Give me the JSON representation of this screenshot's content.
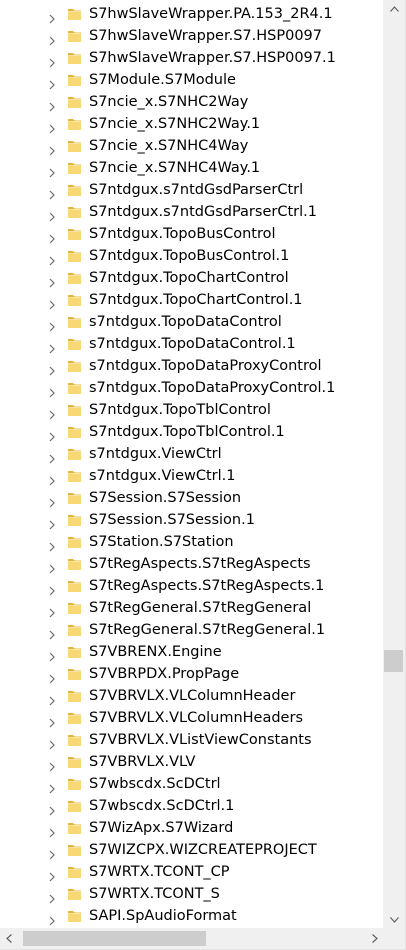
{
  "tree": {
    "items": [
      {
        "label": "S7hwSlaveWrapper.PA.153_2R4.1"
      },
      {
        "label": "S7hwSlaveWrapper.S7.HSP0097"
      },
      {
        "label": "S7hwSlaveWrapper.S7.HSP0097.1"
      },
      {
        "label": "S7Module.S7Module"
      },
      {
        "label": "S7ncie_x.S7NHC2Way"
      },
      {
        "label": "S7ncie_x.S7NHC2Way.1"
      },
      {
        "label": "S7ncie_x.S7NHC4Way"
      },
      {
        "label": "S7ncie_x.S7NHC4Way.1"
      },
      {
        "label": "S7ntdgux.s7ntdGsdParserCtrl"
      },
      {
        "label": "S7ntdgux.s7ntdGsdParserCtrl.1"
      },
      {
        "label": "S7ntdgux.TopoBusControl"
      },
      {
        "label": "S7ntdgux.TopoBusControl.1"
      },
      {
        "label": "S7ntdgux.TopoChartControl"
      },
      {
        "label": "S7ntdgux.TopoChartControl.1"
      },
      {
        "label": "s7ntdgux.TopoDataControl"
      },
      {
        "label": "s7ntdgux.TopoDataControl.1"
      },
      {
        "label": "s7ntdgux.TopoDataProxyControl"
      },
      {
        "label": "s7ntdgux.TopoDataProxyControl.1"
      },
      {
        "label": "S7ntdgux.TopoTblControl"
      },
      {
        "label": "S7ntdgux.TopoTblControl.1"
      },
      {
        "label": "s7ntdgux.ViewCtrl"
      },
      {
        "label": "s7ntdgux.ViewCtrl.1"
      },
      {
        "label": "S7Session.S7Session"
      },
      {
        "label": "S7Session.S7Session.1"
      },
      {
        "label": "S7Station.S7Station"
      },
      {
        "label": "S7tRegAspects.S7tRegAspects"
      },
      {
        "label": "S7tRegAspects.S7tRegAspects.1"
      },
      {
        "label": "S7tRegGeneral.S7tRegGeneral"
      },
      {
        "label": "S7tRegGeneral.S7tRegGeneral.1"
      },
      {
        "label": "S7VBRENX.Engine"
      },
      {
        "label": "S7VBRPDX.PropPage"
      },
      {
        "label": "S7VBRVLX.VLColumnHeader"
      },
      {
        "label": "S7VBRVLX.VLColumnHeaders"
      },
      {
        "label": "S7VBRVLX.VListViewConstants"
      },
      {
        "label": "S7VBRVLX.VLV"
      },
      {
        "label": "S7wbscdx.ScDCtrl"
      },
      {
        "label": "S7wbscdx.ScDCtrl.1"
      },
      {
        "label": "S7WizApx.S7Wizard"
      },
      {
        "label": "S7WIZCPX.WIZCREATEPROJECT"
      },
      {
        "label": "S7WRTX.TCONT_CP"
      },
      {
        "label": "S7WRTX.TCONT_S"
      },
      {
        "label": "SAPI.SpAudioFormat"
      }
    ]
  },
  "icons": {
    "expander": "chevron-right-icon",
    "folder": "folder-icon"
  },
  "colors": {
    "folder_fill": "#f8d775",
    "folder_dark": "#e2b33d",
    "chevron": "#6d6d6d",
    "scrollbar_track": "#f0f0f0",
    "scrollbar_thumb": "#cdcdcd",
    "scroll_arrow": "#606060"
  },
  "scroll": {
    "vertical_position": 0.72,
    "horizontal_position": 0.0
  }
}
